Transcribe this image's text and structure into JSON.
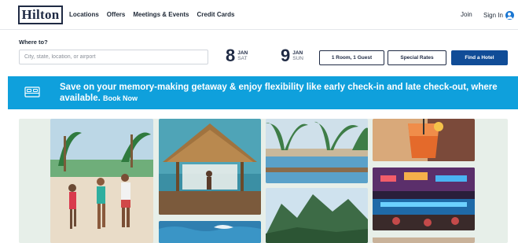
{
  "brand": {
    "logo_text": "Hilton"
  },
  "nav": {
    "items": [
      {
        "label": "Locations"
      },
      {
        "label": "Offers"
      },
      {
        "label": "Meetings & Events"
      },
      {
        "label": "Credit Cards"
      }
    ],
    "join_label": "Join",
    "signin_label": "Sign In"
  },
  "search": {
    "label": "Where to?",
    "placeholder": "City, state, location, or airport",
    "value": ""
  },
  "dates": {
    "checkin": {
      "day": "8",
      "month": "JAN",
      "weekday": "SAT"
    },
    "checkout": {
      "day": "9",
      "month": "JAN",
      "weekday": "SUN"
    }
  },
  "actions": {
    "rooms_guests": "1 Room, 1 Guest",
    "special_rates": "Special Rates",
    "find_hotel": "Find a Hotel"
  },
  "banner": {
    "text": "Save on your memory-making getaway & enjoy flexibility like early check-in and late check-out, where available.",
    "link": "Book Now",
    "icon": "bed-icon"
  },
  "colors": {
    "brand_navy": "#1f2a44",
    "primary_button": "#104c97",
    "banner_blue": "#0fa0dc",
    "user_icon": "#1b77d2"
  },
  "photos": [
    {
      "name": "family-beach-photo"
    },
    {
      "name": "cabana-pool-photo"
    },
    {
      "name": "resort-pool-palms-photo"
    },
    {
      "name": "cocktail-photo"
    },
    {
      "name": "casino-bar-photo"
    },
    {
      "name": "mountain-coast-photo"
    },
    {
      "name": "ocean-photo"
    }
  ]
}
